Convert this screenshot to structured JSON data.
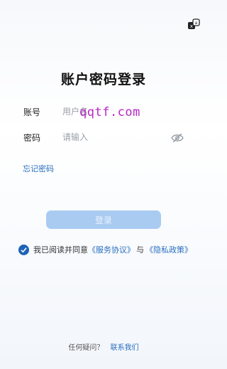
{
  "title": "账户密码登录",
  "account": {
    "label": "账号",
    "placeholder": "用户名"
  },
  "password": {
    "label": "密码",
    "placeholder": "请输入"
  },
  "watermark": "qqtf.com",
  "forgot_password": "忘记密码",
  "login_button": "登录",
  "agreement": {
    "prefix": "我已阅读并同意",
    "service_terms": "《服务协议》",
    "and": "与",
    "privacy_policy": "《隐私政策》"
  },
  "footer": {
    "question": "任何疑问？",
    "contact": "联系我们"
  },
  "colors": {
    "accent": "#1e63b8",
    "link": "#2a6fbf",
    "button_disabled": "#a9cbf1",
    "watermark": "#b726c4"
  },
  "icons": {
    "corner": "language-switch-icon",
    "password_toggle": "eye-hidden-icon",
    "agree": "checkmark-icon"
  }
}
